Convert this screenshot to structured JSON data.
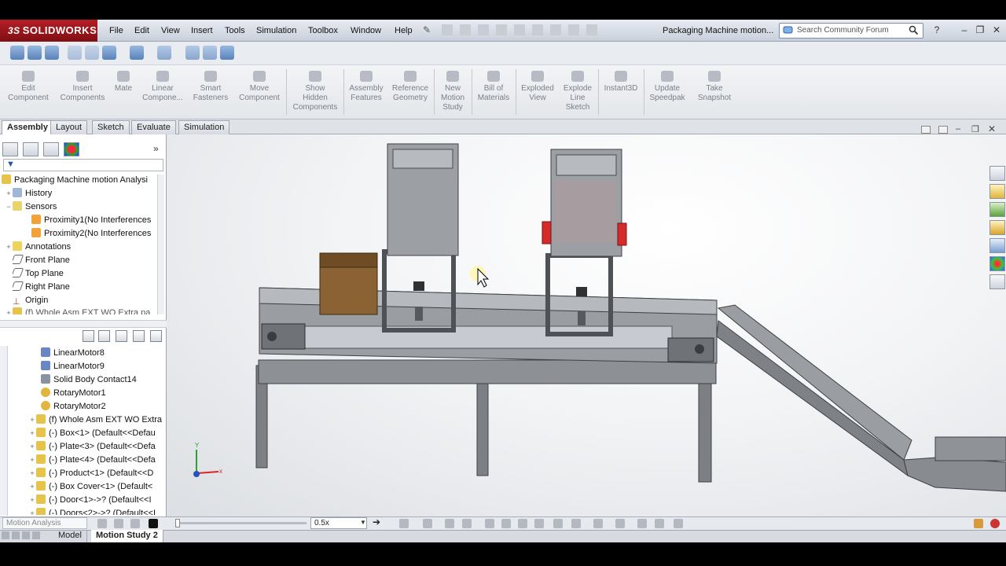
{
  "app": {
    "brand": "SOLIDWORKS",
    "brand_prefix": "3S",
    "doc_title": "Packaging Machine motion..."
  },
  "menu": [
    "File",
    "Edit",
    "View",
    "Insert",
    "Tools",
    "Simulation",
    "Toolbox",
    "Window",
    "Help"
  ],
  "search": {
    "placeholder": "Search Community Forum"
  },
  "commands": [
    {
      "label": "Edit\nComponent"
    },
    {
      "label": "Insert\nComponents"
    },
    {
      "label": "Mate"
    },
    {
      "label": "Linear\nCompone..."
    },
    {
      "label": "Smart\nFasteners"
    },
    {
      "label": "Move\nComponent"
    },
    {
      "label": "Show\nHidden\nComponents"
    },
    {
      "label": "Assembly\nFeatures"
    },
    {
      "label": "Reference\nGeometry"
    },
    {
      "label": "New\nMotion\nStudy"
    },
    {
      "label": "Bill of\nMaterials"
    },
    {
      "label": "Exploded\nView"
    },
    {
      "label": "Explode\nLine\nSketch"
    },
    {
      "label": "Instant3D"
    },
    {
      "label": "Update\nSpeedpak"
    },
    {
      "label": "Take\nSnapshot"
    }
  ],
  "tabs": [
    "Assembly",
    "Layout",
    "Sketch",
    "Evaluate",
    "Simulation"
  ],
  "active_tab": "Assembly",
  "feature_tree": [
    {
      "label": "Packaging Machine motion Analysi",
      "icon": "assembly-icon"
    },
    {
      "label": "History",
      "icon": "history-icon"
    },
    {
      "label": "Sensors",
      "icon": "sensors-icon"
    },
    {
      "label": "Proximity1(No Interferences",
      "icon": "sensor-icon"
    },
    {
      "label": "Proximity2(No Interferences",
      "icon": "sensor-icon"
    },
    {
      "label": "Annotations",
      "icon": "annotations-icon"
    },
    {
      "label": "Front Plane",
      "icon": "plane-icon"
    },
    {
      "label": "Top Plane",
      "icon": "plane-icon"
    },
    {
      "label": "Right Plane",
      "icon": "plane-icon"
    },
    {
      "label": "Origin",
      "icon": "origin-icon"
    },
    {
      "label": "(f) Whole Asm EXT WO Extra pa",
      "icon": "component-icon"
    }
  ],
  "motion_tree": [
    {
      "label": "LinearMotor8",
      "icon": "linear-motor-icon"
    },
    {
      "label": "LinearMotor9",
      "icon": "linear-motor-icon"
    },
    {
      "label": "Solid Body Contact14",
      "icon": "contact-icon"
    },
    {
      "label": "RotaryMotor1",
      "icon": "rotary-motor-icon"
    },
    {
      "label": "RotaryMotor2",
      "icon": "rotary-motor-icon"
    },
    {
      "label": "(f) Whole Asm EXT WO Extra",
      "icon": "component-icon"
    },
    {
      "label": "(-) Box<1> (Default<<Defau",
      "icon": "component-icon"
    },
    {
      "label": "(-) Plate<3> (Default<<Defa",
      "icon": "component-icon"
    },
    {
      "label": "(-) Plate<4> (Default<<Defa",
      "icon": "component-icon"
    },
    {
      "label": "(-) Product<1> (Default<<D",
      "icon": "component-icon"
    },
    {
      "label": "(-) Box Cover<1> (Default<",
      "icon": "component-icon"
    },
    {
      "label": "(-) Door<1>->? (Default<<I",
      "icon": "component-icon"
    },
    {
      "label": "(-) Doors<2>->? (Default<<I",
      "icon": "component-icon"
    }
  ],
  "motion": {
    "study_type": "Motion Analysis",
    "zoom": "0.5x"
  },
  "bottom_tabs": [
    "Model",
    "Motion Study 2"
  ],
  "active_bottom_tab": "Motion Study 2",
  "triad": {
    "x": "x",
    "y": "Y"
  },
  "colors": {
    "brand": "#b51d24",
    "accent": "#4a77b4",
    "highlight": "#d42b2b"
  }
}
